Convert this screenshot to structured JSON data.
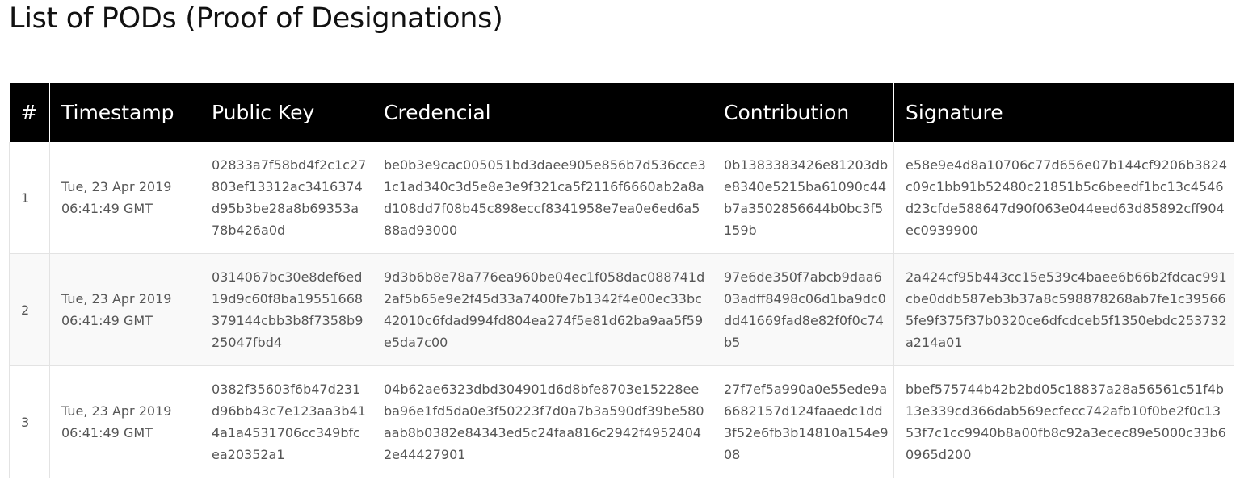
{
  "page": {
    "title": "List of PODs (Proof of Designations)"
  },
  "table": {
    "headers": [
      "#",
      "Timestamp",
      "Public Key",
      "Credencial",
      "Contribution",
      "Signature"
    ],
    "rows": [
      {
        "num": "1",
        "timestamp": "Tue, 23 Apr 2019 06:41:49 GMT",
        "public_key": "02833a7f58bd4f2c1c27803ef13312ac3416374d95b3be28a8b69353a78b426a0d",
        "credencial": "be0b3e9cac005051bd3daee905e856b7d536cce31c1ad340c3d5e8e3e9f321ca5f2116f6660ab2a8ad108dd7f08b45c898eccf8341958e7ea0e6ed6a588ad93000",
        "contribution": "0b1383383426e81203dbe8340e5215ba61090c44b7a3502856644b0bc3f5159b",
        "signature": "e58e9e4d8a10706c77d656e07b144cf9206b3824c09c1bb91b52480c21851b5c6beedf1bc13c4546d23cfde588647d90f063e044eed63d85892cff904ec0939900"
      },
      {
        "num": "2",
        "timestamp": "Tue, 23 Apr 2019 06:41:49 GMT",
        "public_key": "0314067bc30e8def6ed19d9c60f8ba19551668379144cbb3b8f7358b925047fbd4",
        "credencial": "9d3b6b8e78a776ea960be04ec1f058dac088741d2af5b65e9e2f45d33a7400fe7b1342f4e00ec33bc42010c6fdad994fd804ea274f5e81d62ba9aa5f59e5da7c00",
        "contribution": "97e6de350f7abcb9daa603adff8498c06d1ba9dc0dd41669fad8e82f0f0c74b5",
        "signature": "2a424cf95b443cc15e539c4baee6b66b2fdcac991cbe0ddb587eb3b37a8c598878268ab7fe1c395665fe9f375f37b0320ce6dfcdceb5f1350ebdc253732a214a01"
      },
      {
        "num": "3",
        "timestamp": "Tue, 23 Apr 2019 06:41:49 GMT",
        "public_key": "0382f35603f6b47d231d96bb43c7e123aa3b414a1a4531706cc349bfcea20352a1",
        "credencial": "04b62ae6323dbd304901d6d8bfe8703e15228eeba96e1fd5da0e3f50223f7d0a7b3a590df39be580aab8b0382e84343ed5c24faa816c2942f49524042e44427901",
        "contribution": "27f7ef5a990a0e55ede9a6682157d124faaedc1dd3f52e6fb3b14810a154e908",
        "signature": "bbef575744b42b2bd05c18837a28a56561c51f4b13e339cd366dab569ecfecc742afb10f0be2f0c1353f7c1cc9940b8a00fb8c92a3ecec89e5000c33b60965d200"
      }
    ]
  }
}
